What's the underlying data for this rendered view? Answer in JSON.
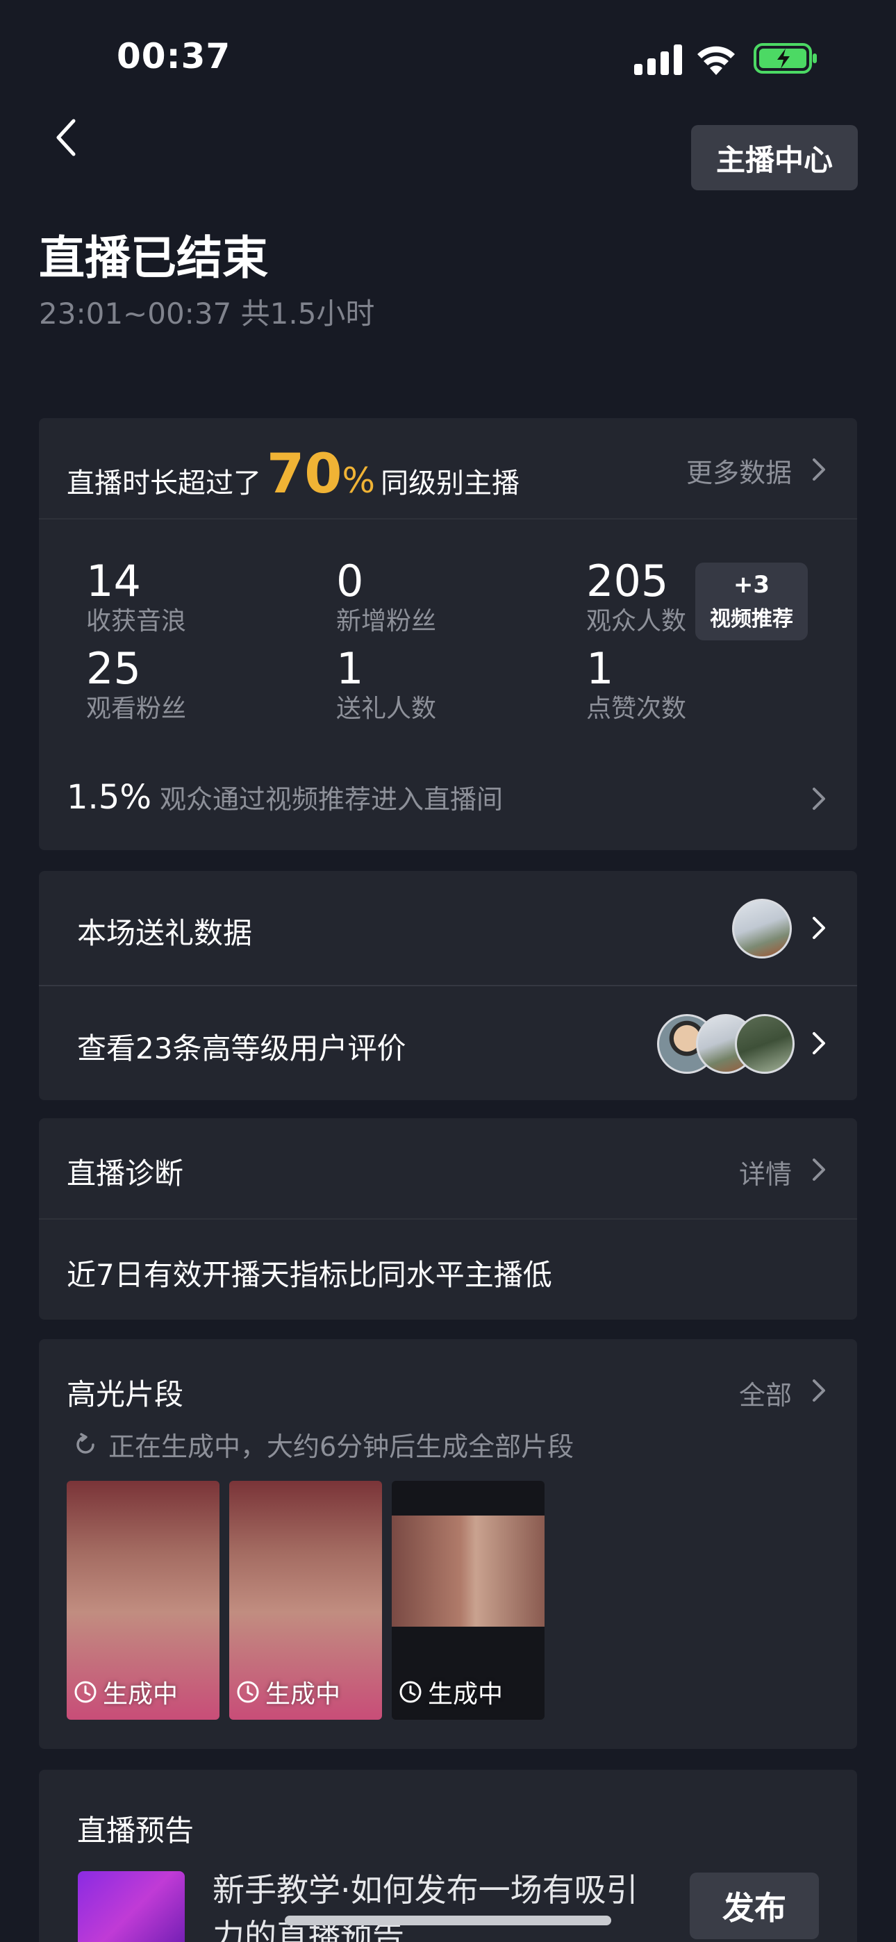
{
  "status_bar": {
    "time": "00:37"
  },
  "header": {
    "anchor_center": "主播中心",
    "title": "直播已结束",
    "subtitle": "23:01~00:37 共1.5小时"
  },
  "summary": {
    "prefix": "直播时长超过了",
    "percent": "70",
    "percent_sign": "%",
    "suffix": "同级别主播",
    "more": "更多数据",
    "stats": [
      {
        "value": "14",
        "label": "收获音浪"
      },
      {
        "value": "0",
        "label": "新增粉丝"
      },
      {
        "value": "205",
        "label": "观众人数"
      },
      {
        "value": "25",
        "label": "观看粉丝"
      },
      {
        "value": "1",
        "label": "送礼人数"
      },
      {
        "value": "1",
        "label": "点赞次数"
      }
    ],
    "badge": {
      "plus": "+3",
      "text": "视频推荐"
    },
    "footer_pct": "1.5%",
    "footer_text": "观众通过视频推荐进入直播间"
  },
  "gifts": {
    "row1": "本场送礼数据",
    "row2": "查看23条高等级用户评价"
  },
  "diagnosis": {
    "title": "直播诊断",
    "detail": "详情",
    "message": "近7日有效开播天指标比同水平主播低"
  },
  "highlights": {
    "title": "高光片段",
    "all": "全部",
    "status": "正在生成中，大约6分钟后生成全部片段",
    "clips": [
      {
        "caption": "生成中"
      },
      {
        "caption": "生成中"
      },
      {
        "caption": "生成中"
      }
    ]
  },
  "preview": {
    "title": "直播预告",
    "text": "新手教学·如何发布一场有吸引力的直播预告",
    "publish": "发布"
  },
  "colors": {
    "background": "#171a24",
    "card": "#23262f",
    "accent": "#f0b335",
    "battery": "#4cd964"
  }
}
